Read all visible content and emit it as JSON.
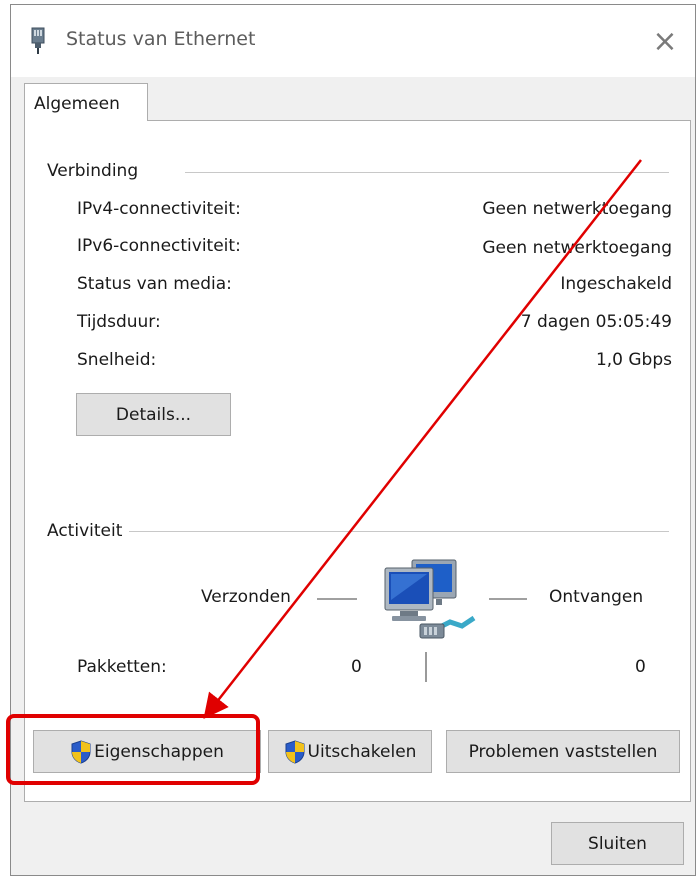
{
  "window": {
    "title": "Status van Ethernet",
    "close_glyph": "×"
  },
  "tabs": [
    {
      "label": "Algemeen"
    }
  ],
  "connection": {
    "group_label": "Verbinding",
    "rows": [
      {
        "label": "IPv4-connectiviteit:",
        "value": "Geen netwerktoegang"
      },
      {
        "label": "IPv6-connectiviteit:",
        "value": "Geen netwerktoegang"
      },
      {
        "label": "Status van media:",
        "value": "Ingeschakeld"
      },
      {
        "label": "Tijdsduur:",
        "value": "7 dagen 05:05:49"
      },
      {
        "label": "Snelheid:",
        "value": "1,0 Gbps"
      }
    ],
    "details_button": "Details..."
  },
  "activity": {
    "group_label": "Activiteit",
    "sent_label": "Verzonden",
    "received_label": "Ontvangen",
    "packets_label": "Pakketten:",
    "packets_sent": "0",
    "packets_received": "0",
    "icon": "network-computers-icon"
  },
  "buttons": {
    "properties": "Eigenschappen",
    "disable": "Uitschakelen",
    "diagnose": "Problemen vaststellen",
    "close": "Sluiten"
  },
  "annotation": {
    "color": "#e00000"
  }
}
